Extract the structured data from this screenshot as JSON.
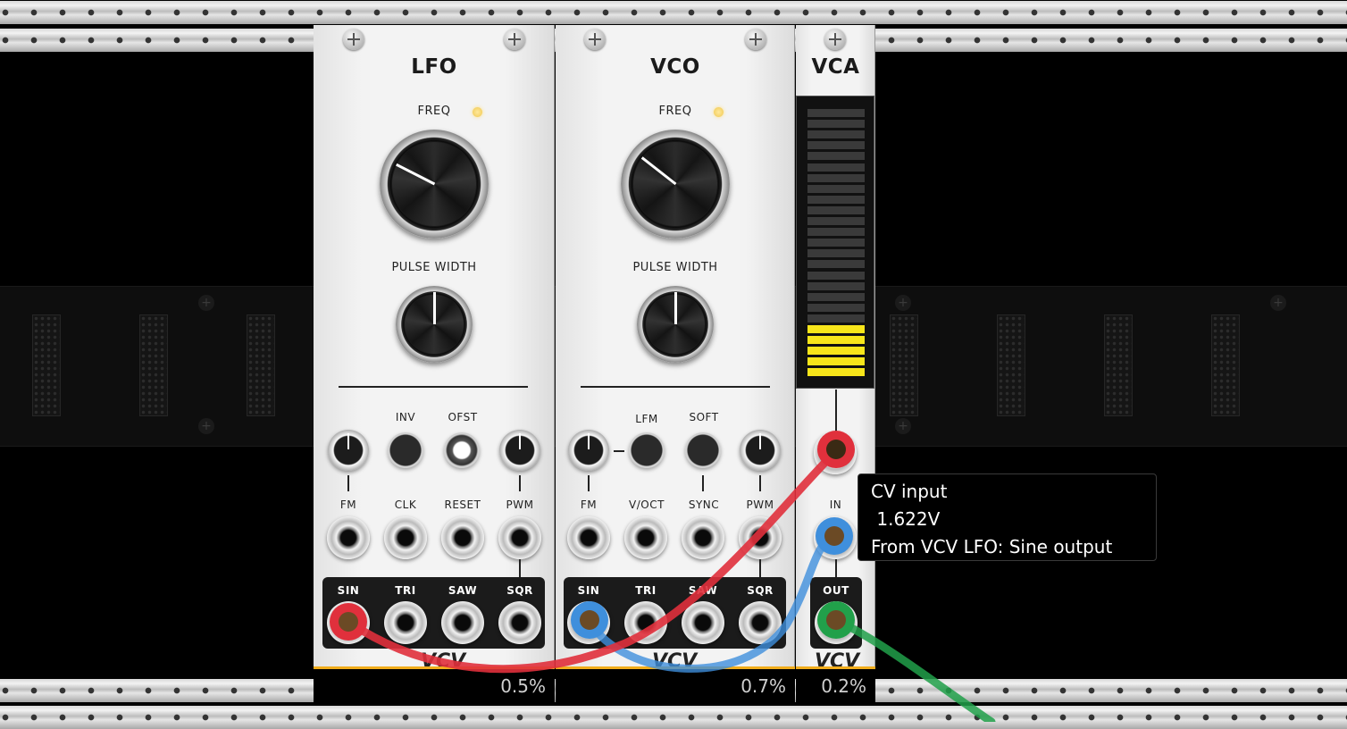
{
  "modules": {
    "lfo": {
      "title": "LFO",
      "freq_label": "FREQ",
      "pulse_width_label": "PULSE WIDTH",
      "switch_labels": {
        "inv": "INV",
        "ofst": "OFST"
      },
      "input_labels": [
        "FM",
        "CLK",
        "RESET",
        "PWM"
      ],
      "output_labels": [
        "SIN",
        "TRI",
        "SAW",
        "SQR"
      ],
      "brand": "VCV",
      "cpu": "0.5%"
    },
    "vco": {
      "title": "VCO",
      "freq_label": "FREQ",
      "pulse_width_label": "PULSE WIDTH",
      "switch_labels": {
        "lfm": "LFM",
        "soft": "SOFT"
      },
      "input_labels": [
        "FM",
        "V/OCT",
        "SYNC",
        "PWM"
      ],
      "output_labels": [
        "SIN",
        "TRI",
        "SAW",
        "SQR"
      ],
      "brand": "VCV",
      "cpu": "0.7%"
    },
    "vca": {
      "title": "VCA",
      "in_label": "IN",
      "out_label": "OUT",
      "brand": "VCV",
      "cpu": "0.2%",
      "meter_segments_lit": 5,
      "meter_segments_total": 25
    }
  },
  "tooltip": {
    "line1": "CV input",
    "line2": " 1.622V",
    "line3": "From VCV LFO: Sine output"
  },
  "colors": {
    "cable_red": "#e0303c",
    "cable_blue": "#3f8fdc",
    "cable_green": "#21a04a",
    "accent": "#f1ad1c",
    "meter_lit": "#f7e51a"
  }
}
